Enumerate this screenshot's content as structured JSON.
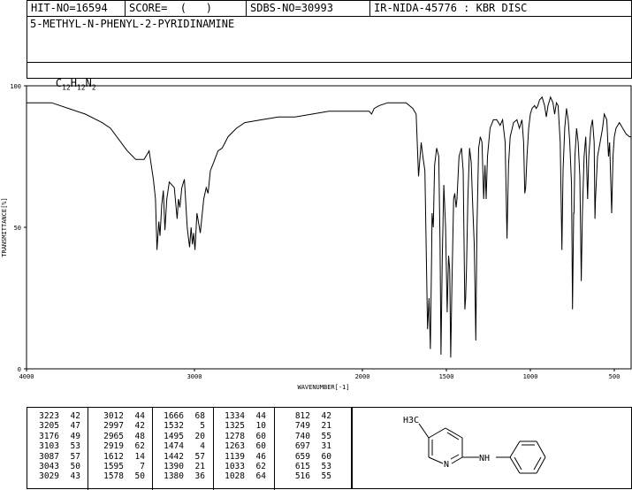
{
  "header": {
    "hit_no": "HIT-NO=16594",
    "score": "SCORE=  (   )",
    "sdbs_no": "SDBS-NO=30993",
    "ir_info": "IR-NIDA-45776 : KBR DISC"
  },
  "compound": {
    "name": "5-METHYL-N-PHENYL-2-PYRIDINAMINE",
    "formula_c": "C",
    "formula_c_sub": "12",
    "formula_h": "H",
    "formula_h_sub": "12",
    "formula_n": "N",
    "formula_n_sub": "2"
  },
  "chart_data": {
    "type": "line",
    "xlabel": "WAVENUMBER[-1]",
    "ylabel": "TRANSMITTANCE[%]",
    "xlim": [
      4000,
      400
    ],
    "ylim": [
      0,
      100
    ],
    "x_ticks": [
      4000,
      3000,
      2000,
      1500,
      1000,
      500
    ],
    "y_ticks": [
      0,
      50,
      100
    ],
    "series": [
      {
        "points": [
          [
            4000,
            94
          ],
          [
            3850,
            94
          ],
          [
            3750,
            92
          ],
          [
            3650,
            90
          ],
          [
            3550,
            87
          ],
          [
            3500,
            85
          ],
          [
            3450,
            81
          ],
          [
            3400,
            77
          ],
          [
            3350,
            74
          ],
          [
            3300,
            74
          ],
          [
            3270,
            77
          ],
          [
            3245,
            67
          ],
          [
            3232,
            60
          ],
          [
            3223,
            42
          ],
          [
            3212,
            52
          ],
          [
            3205,
            47
          ],
          [
            3195,
            58
          ],
          [
            3185,
            63
          ],
          [
            3176,
            49
          ],
          [
            3165,
            60
          ],
          [
            3150,
            66
          ],
          [
            3120,
            64
          ],
          [
            3103,
            53
          ],
          [
            3095,
            60
          ],
          [
            3087,
            57
          ],
          [
            3075,
            64
          ],
          [
            3060,
            67
          ],
          [
            3043,
            50
          ],
          [
            3035,
            46
          ],
          [
            3029,
            43
          ],
          [
            3020,
            50
          ],
          [
            3012,
            44
          ],
          [
            3005,
            48
          ],
          [
            2997,
            42
          ],
          [
            2985,
            55
          ],
          [
            2965,
            48
          ],
          [
            2945,
            60
          ],
          [
            2930,
            64
          ],
          [
            2919,
            62
          ],
          [
            2905,
            70
          ],
          [
            2885,
            73
          ],
          [
            2860,
            77
          ],
          [
            2835,
            78
          ],
          [
            2800,
            82
          ],
          [
            2750,
            85
          ],
          [
            2700,
            87
          ],
          [
            2600,
            88
          ],
          [
            2500,
            89
          ],
          [
            2400,
            89
          ],
          [
            2300,
            90
          ],
          [
            2200,
            91
          ],
          [
            2100,
            91
          ],
          [
            2000,
            91
          ],
          [
            1960,
            91
          ],
          [
            1945,
            90
          ],
          [
            1930,
            92
          ],
          [
            1900,
            93
          ],
          [
            1850,
            94
          ],
          [
            1800,
            94
          ],
          [
            1740,
            94
          ],
          [
            1700,
            92
          ],
          [
            1680,
            90
          ],
          [
            1666,
            68
          ],
          [
            1650,
            80
          ],
          [
            1640,
            75
          ],
          [
            1628,
            70
          ],
          [
            1612,
            14
          ],
          [
            1603,
            25
          ],
          [
            1595,
            7
          ],
          [
            1588,
            40
          ],
          [
            1585,
            55
          ],
          [
            1578,
            50
          ],
          [
            1570,
            72
          ],
          [
            1558,
            78
          ],
          [
            1545,
            75
          ],
          [
            1538,
            45
          ],
          [
            1532,
            5
          ],
          [
            1524,
            40
          ],
          [
            1515,
            65
          ],
          [
            1505,
            50
          ],
          [
            1495,
            20
          ],
          [
            1487,
            40
          ],
          [
            1480,
            35
          ],
          [
            1474,
            4
          ],
          [
            1467,
            30
          ],
          [
            1457,
            60
          ],
          [
            1450,
            62
          ],
          [
            1442,
            57
          ],
          [
            1437,
            60
          ],
          [
            1425,
            75
          ],
          [
            1410,
            78
          ],
          [
            1400,
            70
          ],
          [
            1390,
            21
          ],
          [
            1385,
            25
          ],
          [
            1380,
            36
          ],
          [
            1372,
            60
          ],
          [
            1362,
            78
          ],
          [
            1352,
            73
          ],
          [
            1345,
            60
          ],
          [
            1334,
            44
          ],
          [
            1330,
            30
          ],
          [
            1325,
            10
          ],
          [
            1318,
            50
          ],
          [
            1308,
            78
          ],
          [
            1298,
            82
          ],
          [
            1288,
            80
          ],
          [
            1278,
            60
          ],
          [
            1270,
            72
          ],
          [
            1263,
            60
          ],
          [
            1255,
            75
          ],
          [
            1240,
            85
          ],
          [
            1220,
            88
          ],
          [
            1200,
            88
          ],
          [
            1180,
            86
          ],
          [
            1165,
            88
          ],
          [
            1150,
            80
          ],
          [
            1139,
            46
          ],
          [
            1130,
            72
          ],
          [
            1120,
            82
          ],
          [
            1100,
            87
          ],
          [
            1080,
            88
          ],
          [
            1065,
            85
          ],
          [
            1050,
            88
          ],
          [
            1040,
            80
          ],
          [
            1033,
            62
          ],
          [
            1028,
            64
          ],
          [
            1020,
            75
          ],
          [
            1010,
            85
          ],
          [
            1000,
            90
          ],
          [
            990,
            92
          ],
          [
            975,
            93
          ],
          [
            965,
            92
          ],
          [
            955,
            93
          ],
          [
            945,
            95
          ],
          [
            930,
            96
          ],
          [
            915,
            93
          ],
          [
            905,
            89
          ],
          [
            895,
            93
          ],
          [
            880,
            96
          ],
          [
            865,
            94
          ],
          [
            855,
            90
          ],
          [
            845,
            94
          ],
          [
            835,
            93
          ],
          [
            822,
            80
          ],
          [
            812,
            42
          ],
          [
            805,
            70
          ],
          [
            795,
            85
          ],
          [
            785,
            92
          ],
          [
            775,
            88
          ],
          [
            765,
            80
          ],
          [
            755,
            65
          ],
          [
            749,
            21
          ],
          [
            742,
            55
          ],
          [
            740,
            55
          ],
          [
            735,
            75
          ],
          [
            725,
            85
          ],
          [
            715,
            80
          ],
          [
            705,
            68
          ],
          [
            697,
            31
          ],
          [
            690,
            55
          ],
          [
            680,
            75
          ],
          [
            670,
            82
          ],
          [
            659,
            60
          ],
          [
            652,
            75
          ],
          [
            640,
            85
          ],
          [
            630,
            88
          ],
          [
            620,
            80
          ],
          [
            615,
            53
          ],
          [
            612,
            60
          ],
          [
            600,
            75
          ],
          [
            585,
            80
          ],
          [
            570,
            85
          ],
          [
            560,
            90
          ],
          [
            545,
            88
          ],
          [
            535,
            75
          ],
          [
            528,
            80
          ],
          [
            516,
            55
          ],
          [
            508,
            75
          ],
          [
            500,
            82
          ],
          [
            490,
            85
          ],
          [
            470,
            87
          ],
          [
            450,
            85
          ],
          [
            430,
            83
          ],
          [
            410,
            82
          ],
          [
            400,
            82
          ]
        ]
      }
    ]
  },
  "peak_table": {
    "columns": [
      [
        [
          "3223",
          "42"
        ],
        [
          "3205",
          "47"
        ],
        [
          "3176",
          "49"
        ],
        [
          "3103",
          "53"
        ],
        [
          "3087",
          "57"
        ],
        [
          "3043",
          "50"
        ],
        [
          "3029",
          "43"
        ]
      ],
      [
        [
          "3012",
          "44"
        ],
        [
          "2997",
          "42"
        ],
        [
          "2965",
          "48"
        ],
        [
          "2919",
          "62"
        ],
        [
          "1612",
          "14"
        ],
        [
          "1595",
          "7"
        ],
        [
          "1578",
          "50"
        ]
      ],
      [
        [
          "1666",
          "68"
        ],
        [
          "1532",
          "5"
        ],
        [
          "1495",
          "20"
        ],
        [
          "1474",
          "4"
        ],
        [
          "1442",
          "57"
        ],
        [
          "1390",
          "21"
        ],
        [
          "1380",
          "36"
        ]
      ],
      [
        [
          "1334",
          "44"
        ],
        [
          "1325",
          "10"
        ],
        [
          "1278",
          "60"
        ],
        [
          "1263",
          "60"
        ],
        [
          "1139",
          "46"
        ],
        [
          "1033",
          "62"
        ],
        [
          "1028",
          "64"
        ]
      ],
      [
        [
          "812",
          "42"
        ],
        [
          "749",
          "21"
        ],
        [
          "740",
          "55"
        ],
        [
          "697",
          "31"
        ],
        [
          "659",
          "60"
        ],
        [
          "615",
          "53"
        ],
        [
          "516",
          "55"
        ]
      ]
    ]
  },
  "structure": {
    "methyl_label": "H3C",
    "nh_label": "NH",
    "n_label": "N"
  }
}
